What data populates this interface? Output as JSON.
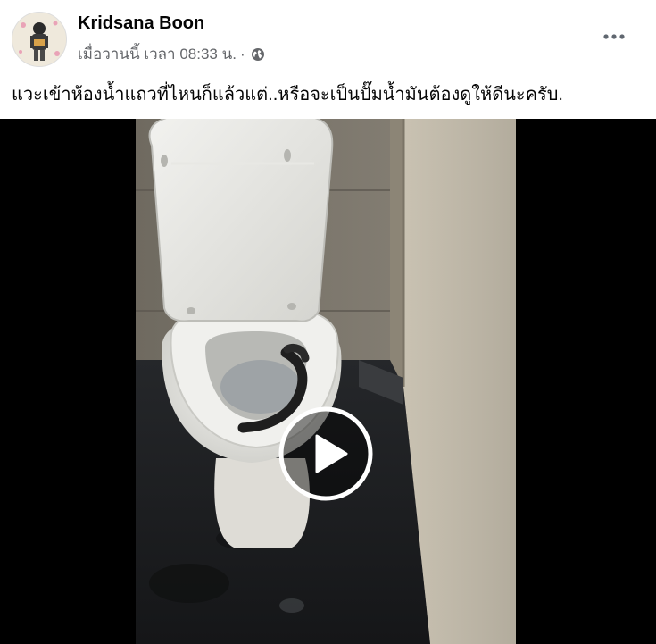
{
  "post": {
    "author": "Kridsana Boon",
    "timestamp": "เมื่อวานนี้ เวลา 08:33 น.",
    "separator": "·",
    "privacy_icon": "globe-icon",
    "menu_icon": "more-horizontal-icon",
    "caption": "แวะเข้าห้องน้ำแถวที่ไหนก็แล้วแต่..หรือจะเป็นปั๊มน้ำมันต้องดูให้ดีนะครับ."
  },
  "video": {
    "play_icon": "play-icon",
    "scene": "toilet-with-snake-thumbnail"
  },
  "colors": {
    "author_text": "#050505",
    "meta_text": "#65676b",
    "video_background": "#000000"
  }
}
